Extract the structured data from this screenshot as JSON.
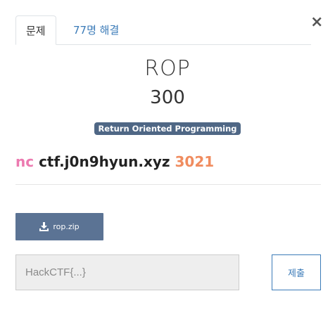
{
  "modal": {
    "close_label": "×",
    "tabs": [
      {
        "label": "문제",
        "active": true
      },
      {
        "label": "77명 해결",
        "active": false
      }
    ]
  },
  "challenge": {
    "name": "ROP",
    "value": "300",
    "tag": "Return Oriented Programming",
    "description": {
      "command": "nc",
      "host": "ctf.j0n9hyun.xyz",
      "port": "3021"
    },
    "file": {
      "label": "rop.zip",
      "icon": "download-icon"
    }
  },
  "submission": {
    "placeholder": "HackCTF{...}",
    "value": "",
    "submit_label": "제출"
  },
  "colors": {
    "accent": "#3b7bb8",
    "tag_bg": "#4f6785",
    "file_button_bg": "#5b7394",
    "nc_color": "#ec7ab0",
    "port_color": "#f08c5f"
  }
}
